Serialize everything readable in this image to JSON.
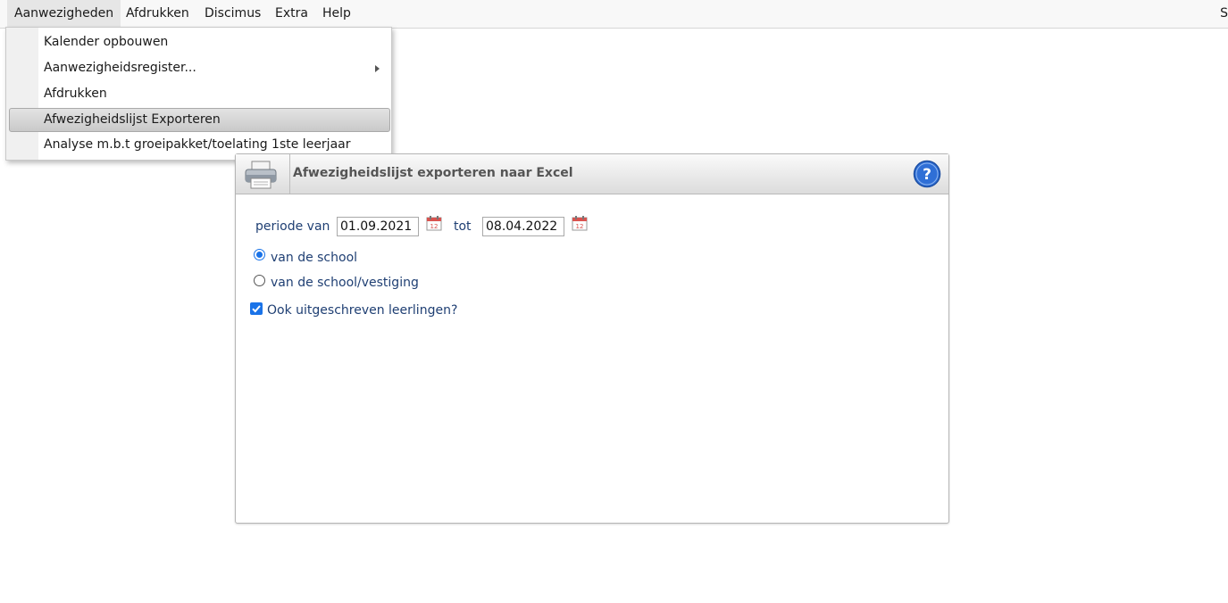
{
  "menubar": {
    "items": [
      "Aanwezigheden",
      "Afdrukken",
      "Discimus",
      "Extra",
      "Help"
    ],
    "right_text": "S"
  },
  "dropdown": {
    "items": [
      {
        "label": "Kalender opbouwen"
      },
      {
        "label": "Aanwezigheidsregister..."
      },
      {
        "label": "Afdrukken"
      },
      {
        "label": "Afwezigheidslijst Exporteren"
      },
      {
        "label": "Analyse m.b.t groeipakket/toelating 1ste leerjaar"
      }
    ]
  },
  "panel": {
    "title": "Afwezigheidslijst exporteren naar Excel",
    "period_label": "periode van",
    "from_date": "01.09.2021",
    "to_label": "tot",
    "to_date": "08.04.2022",
    "radio_school": "van de school",
    "radio_school_vestiging": "van de school/vestiging",
    "checkbox_label": "Ook uitgeschreven leerlingen?",
    "radio_selected": "van de school",
    "checkbox_checked": true
  },
  "colors": {
    "accent": "#1a73e8",
    "label_blue": "#1f3f73",
    "title_gray": "#555555"
  }
}
